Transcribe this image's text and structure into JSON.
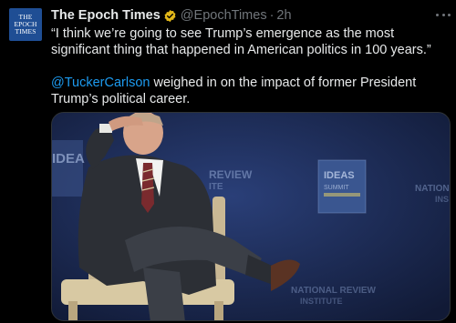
{
  "tweet": {
    "author_name": "The Epoch Times",
    "handle": "@EpochTimes",
    "separator": "·",
    "time": "2h",
    "avatar_lines": [
      "THE",
      "EPOCH",
      "TIMES"
    ],
    "quote": "“I think we’re going to see Trump’s emergence as the most significant thing that happened in American politics in 100 years.”",
    "mention": "@TuckerCarlson",
    "body_rest": " weighed in on the impact of former President Trump’s political career.",
    "verified_color": "#e2b719",
    "mention_color": "#1d9bf0"
  },
  "media": {
    "backdrop_texts": {
      "ideas_left": "IDEA",
      "review": "REVIEW",
      "review_sub": "ITE",
      "ideas_box": "IDEAS",
      "ideas_box_sub": "SUMMIT",
      "nation": "NATION",
      "nation_sub": "INS",
      "bottom": "NATIONAL REVIEW",
      "bottom_sub": "INSTITUTE"
    }
  }
}
